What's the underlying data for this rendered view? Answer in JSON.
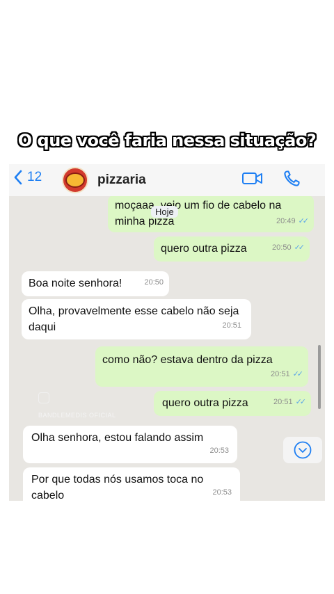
{
  "caption": "O que você faria nessa situação?",
  "header": {
    "back_count": "12",
    "contact_name": "pizzaria",
    "accent": "#1e7ff3"
  },
  "date_label": "Hoje",
  "messages": [
    {
      "dir": "out",
      "text": "moçaaa, veio um fio de cabelo na minha pizza",
      "time": "20:49",
      "ticks": "✓✓"
    },
    {
      "dir": "out",
      "text": "quero outra pizza",
      "time": "20:50",
      "ticks": "✓✓"
    },
    {
      "dir": "in",
      "text": "Boa noite senhora!",
      "time": "20:50"
    },
    {
      "dir": "in",
      "text": "Olha, provavelmente esse cabelo não seja daqui",
      "time": "20:51"
    },
    {
      "dir": "out",
      "text": "como não? estava dentro da pizza",
      "time": "20:51",
      "ticks": "✓✓"
    },
    {
      "dir": "out",
      "text": "quero outra pizza",
      "time": "20:51",
      "ticks": "✓✓"
    },
    {
      "dir": "in",
      "text": "Olha senhora, estou falando assim",
      "time": "20:53"
    },
    {
      "dir": "in",
      "text": "Por que todas nós usamos toca no cabelo",
      "time": "20:53"
    }
  ],
  "watermark": "BANDLEMEDIS OFICIAL",
  "colors": {
    "outgoing": "#dcf7c5",
    "incoming": "#ffffff",
    "chat_bg": "#e8e6e2",
    "ticks": "#5aa6e8"
  }
}
